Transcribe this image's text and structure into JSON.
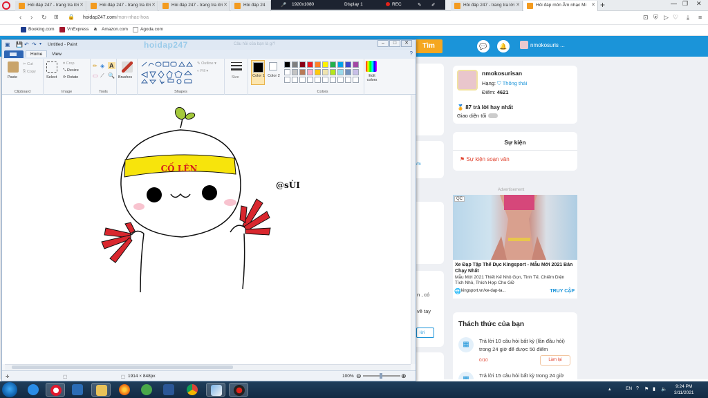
{
  "browser": {
    "tabs": [
      {
        "label": "Hỏi đáp 247 - trang tra lời"
      },
      {
        "label": "Hỏi đáp 247 - trang tra lời"
      },
      {
        "label": "Hỏi đáp 247 - trang tra lời"
      },
      {
        "label": "Hỏi đáp 24"
      },
      {
        "label": "Hỏi đáp 247 - trang tra lời"
      },
      {
        "label": "Hỏi đáp môn Âm nhạc Mi"
      }
    ],
    "url_host": "hoidap247.com",
    "url_path": "/mon-nhac-hoa",
    "bookmarks": [
      "Booking.com",
      "VnExpress",
      "Amazon.com",
      "Agoda.com"
    ]
  },
  "recorder": {
    "resolution": "1920x1080",
    "display": "Display 1",
    "rec": "REC"
  },
  "site": {
    "search_button": "Tìm",
    "username_header": "nmokosuris ...",
    "profile": {
      "name": "nmokosurisan",
      "rank_label": "Hạng:",
      "rank_value": "Thông thái",
      "points_label": "Điểm:",
      "points_value": "4621",
      "best_answers": "87 trả lời hay nhất",
      "dark_mode": "Giao diện tối"
    },
    "events": {
      "title": "Sự kiện",
      "link": "Sự kiện soạn văn"
    },
    "ad": {
      "label": "Advertisement",
      "badge": "QC",
      "title": "Xe Đạp Tập Thể Dục Kingsport - Mẫu Mới 2021 Bán Chạy Nhất",
      "desc": "Mẫu Mới 2021 Thiết Kế Nhỏ Gọn, Tinh Tế, Chiếm Diện Tích Nhỏ, Thích Hợp Cho GĐ",
      "url": "kingsport.vn/xe-dap-ta...",
      "cta": "TRUY CẬP"
    },
    "challenge": {
      "title": "Thách thức của bạn",
      "items": [
        {
          "text": "Trả lời 10 câu hỏi bất kỳ (lần đầu hỏi) trong 24 giờ để được 50 điểm",
          "progress": "0/10",
          "button": "Làm lại"
        },
        {
          "text": "Trả lời 15 câu hỏi bất kỳ trong 24 giờ"
        }
      ]
    },
    "partial_texts": [
      "n , có",
      "về tay",
      "lời",
      "/m"
    ],
    "search_placeholder": "Câu hỏi của bạn là gì?",
    "logo_watermark": "hoidap247"
  },
  "paint": {
    "title": "Untitled - Paint",
    "tabs": [
      "Home",
      "View"
    ],
    "groups": {
      "clipboard": "Clipboard",
      "image": "Image",
      "tools": "Tools",
      "shapes": "Shapes",
      "colors": "Colors"
    },
    "buttons": {
      "paste": "Paste",
      "cut": "Cut",
      "copy": "Copy",
      "select": "Select",
      "crop": "Crop",
      "resize": "Resize",
      "rotate": "Rotate",
      "brushes": "Brushes",
      "outline": "Outline",
      "fill": "Fill",
      "size": "Size",
      "color1": "Color 1",
      "color2": "Color 2",
      "edit_colors": "Edit colors"
    },
    "canvas_texts": {
      "headband": "CỐ LÊN",
      "signature": "@sÙI"
    },
    "status": {
      "dimensions": "1914 × 848px",
      "zoom": "100%"
    },
    "palette": [
      "#000000",
      "#7f7f7f",
      "#880015",
      "#ed1c24",
      "#ff7f27",
      "#fff200",
      "#22b14c",
      "#00a2e8",
      "#3f48cc",
      "#a349a4",
      "#ffffff",
      "#c3c3c3",
      "#b97a57",
      "#ffaec9",
      "#ffc90e",
      "#efe4b0",
      "#b5e61d",
      "#99d9ea",
      "#7092be",
      "#c8bfe7",
      "#ffffff",
      "#ffffff",
      "#ffffff",
      "#ffffff",
      "#ffffff",
      "#ffffff",
      "#ffffff",
      "#ffffff",
      "#ffffff",
      "#ffffff"
    ]
  },
  "taskbar": {
    "lang": "EN",
    "time": "9:24 PM",
    "date": "3/11/2021",
    "apps": [
      "internet-explorer",
      "opera",
      "media-player",
      "file-explorer",
      "firefox",
      "green-app",
      "word",
      "chrome",
      "paint",
      "recorder"
    ]
  },
  "colors": {
    "brand": "#1b94d9",
    "search_button": "#f5a720",
    "accent_red": "#e0432f"
  }
}
